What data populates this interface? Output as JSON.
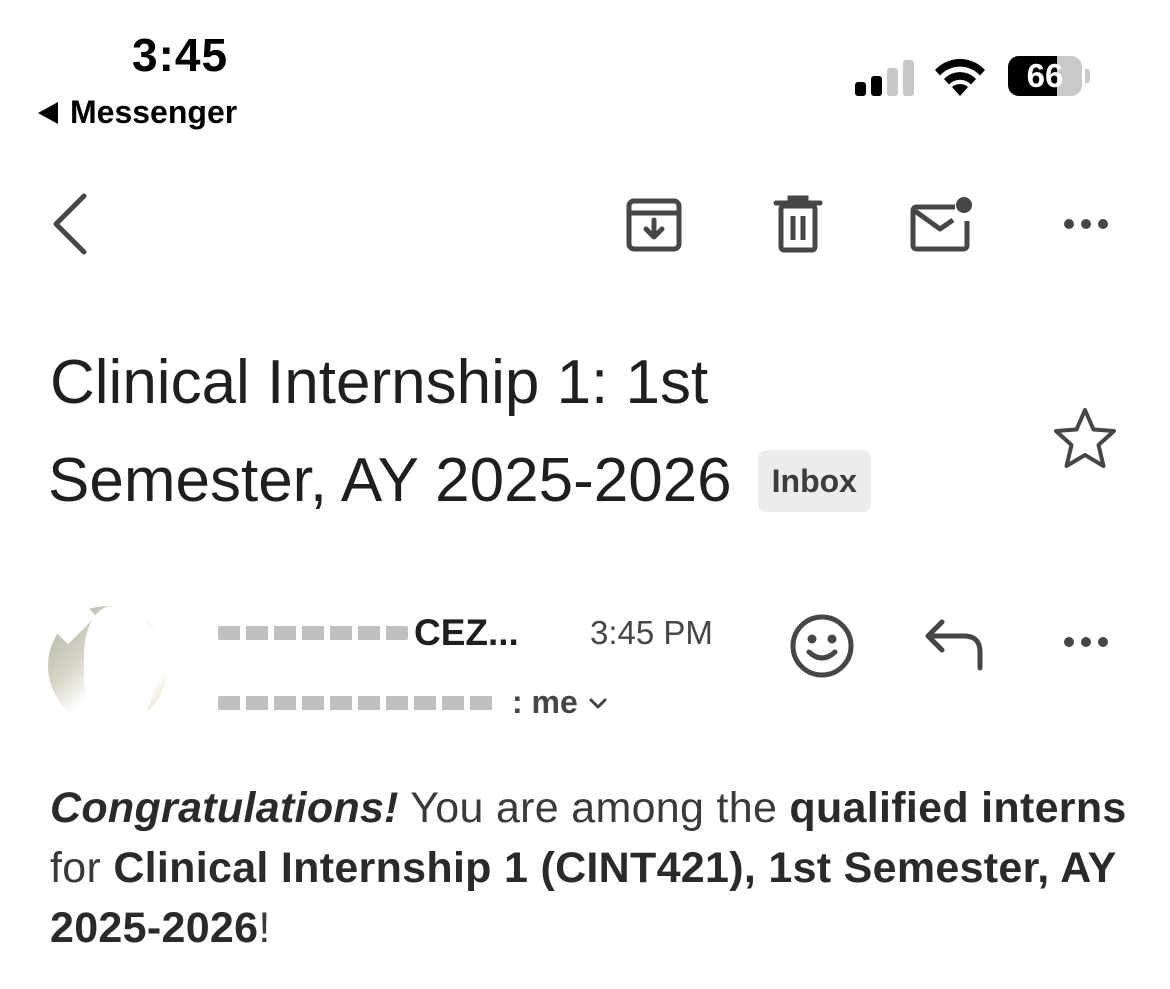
{
  "status_bar": {
    "time": "3:45",
    "back_app_label": "Messenger",
    "battery_level": "66",
    "battery_fraction": 0.66,
    "signal_bars_active": 2,
    "signal_bars_total": 4
  },
  "toolbar": {
    "back_icon": "chevron-left-icon",
    "archive_icon": "archive-icon",
    "delete_icon": "trash-icon",
    "mark_unread_icon": "mail-unread-icon",
    "more_icon": "more-horizontal-icon"
  },
  "email": {
    "subject_line1": "Clinical Internship 1: 1st",
    "subject_line2": "Semester, AY 2025-2026",
    "label_chip": "Inbox",
    "sender_name_visible": "CEZ...",
    "time": "3:45 PM",
    "recipients_visible": ": me",
    "body": {
      "congrats": "Congratulations!",
      "text1": " You are among the ",
      "bold1": "qualified interns",
      "text2": " for ",
      "bold2": "Clinical Internship 1 (CINT421), 1st Semester, AY 2025-2026",
      "text3": "!"
    }
  },
  "colors": {
    "icon_gray": "#444746",
    "chip_bg": "#ececec",
    "text_dark": "#1f1f1f"
  }
}
